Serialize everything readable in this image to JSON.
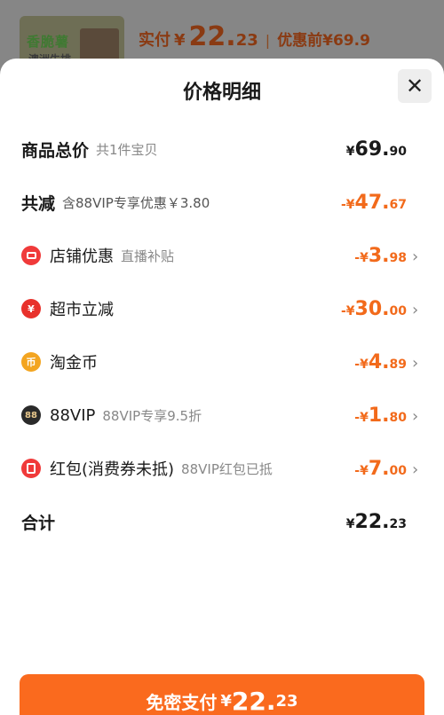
{
  "header": {
    "thumb_text_1": "香脆薯",
    "thumb_text_2": "澳洲牛排",
    "paid_label": "实付",
    "paid_currency": "¥",
    "paid_int": "22.",
    "paid_dec": "23",
    "separator": "|",
    "before_label": "优惠前",
    "before_price": "¥69.9"
  },
  "sheet": {
    "title": "价格明细",
    "close_icon": "✕",
    "total_goods": {
      "label": "商品总价",
      "sub": "共1件宝贝",
      "cur": "¥",
      "int": "69.",
      "dec": "90"
    },
    "total_discount": {
      "label": "共减",
      "sub": "含88VIP专享优惠￥3.80",
      "cur": "-¥",
      "int": "47.",
      "dec": "67"
    },
    "items": [
      {
        "icon": "shop-coupon-icon",
        "label": "店铺优惠",
        "sub": "直播补贴",
        "cur": "-¥",
        "int": "3.",
        "dec": "98"
      },
      {
        "icon": "supermarket-discount-icon",
        "label": "超市立减",
        "sub": "",
        "cur": "-¥",
        "int": "30.",
        "dec": "00"
      },
      {
        "icon": "gold-coin-icon",
        "label": "淘金币",
        "sub": "",
        "cur": "-¥",
        "int": "4.",
        "dec": "89"
      },
      {
        "icon": "vip88-icon",
        "label": "88VIP",
        "sub": "88VIP专享9.5折",
        "cur": "-¥",
        "int": "1.",
        "dec": "80"
      },
      {
        "icon": "red-packet-icon",
        "label": "红包(消费券未抵)",
        "sub": "88VIP红包已抵",
        "cur": "-¥",
        "int": "7.",
        "dec": "00"
      }
    ],
    "grand_total": {
      "label": "合计",
      "cur": "¥",
      "int": "22.",
      "dec": "23"
    },
    "chevron": "›"
  },
  "pay_button": {
    "label": "免密支付",
    "cur": "¥",
    "int": "22.",
    "dec": "23"
  },
  "colors": {
    "accent_orange": "#f26a1b",
    "button_orange": "#fa6a1e"
  }
}
